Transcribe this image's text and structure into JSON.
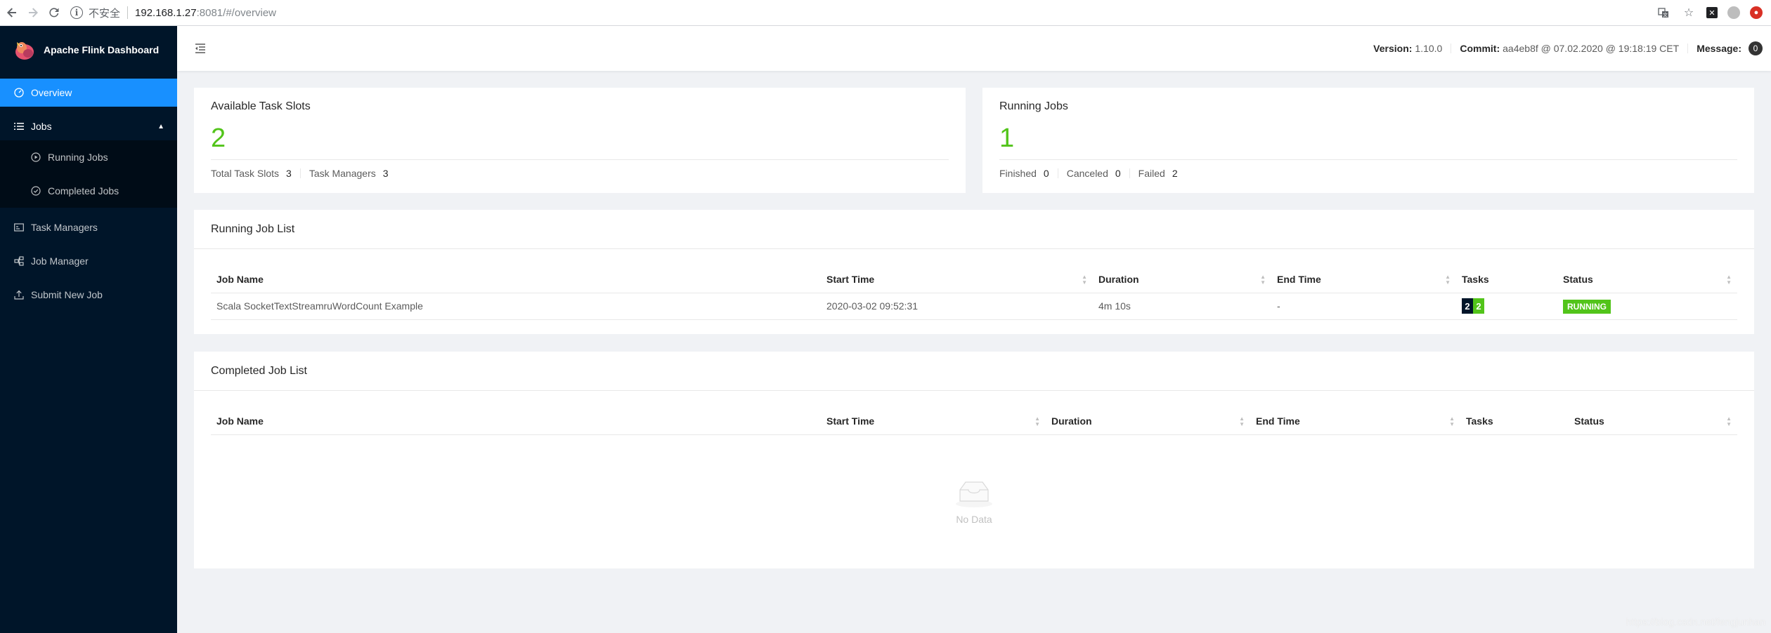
{
  "browser": {
    "insecure_label": "不安全",
    "url_host": "192.168.1.27",
    "url_rest": ":8081/#/overview"
  },
  "sidebar": {
    "logo_text": "Apache Flink Dashboard",
    "items": [
      {
        "label": "Overview"
      },
      {
        "label": "Jobs"
      },
      {
        "label": "Running Jobs"
      },
      {
        "label": "Completed Jobs"
      },
      {
        "label": "Task Managers"
      },
      {
        "label": "Job Manager"
      },
      {
        "label": "Submit New Job"
      }
    ]
  },
  "header": {
    "version_label": "Version:",
    "version_value": "1.10.0",
    "commit_label": "Commit:",
    "commit_value": "aa4eb8f @ 07.02.2020 @ 19:18:19 CET",
    "message_label": "Message:",
    "message_count": "0"
  },
  "slots": {
    "title": "Available Task Slots",
    "value": "2",
    "total_label": "Total Task Slots",
    "total_value": "3",
    "tm_label": "Task Managers",
    "tm_value": "3"
  },
  "running": {
    "title": "Running Jobs",
    "value": "1",
    "finished_label": "Finished",
    "finished_value": "0",
    "canceled_label": "Canceled",
    "canceled_value": "0",
    "failed_label": "Failed",
    "failed_value": "2"
  },
  "running_list": {
    "title": "Running Job List",
    "columns": [
      "Job Name",
      "Start Time",
      "Duration",
      "End Time",
      "Tasks",
      "Status"
    ],
    "rows": [
      {
        "job_name": "Scala SocketTextStreamruWordCount Example",
        "start_time": "2020-03-02 09:52:31",
        "duration": "4m 10s",
        "end_time": "-",
        "tasks_a": "2",
        "tasks_b": "2",
        "status": "RUNNING"
      }
    ]
  },
  "completed_list": {
    "title": "Completed Job List",
    "columns": [
      "Job Name",
      "Start Time",
      "Duration",
      "End Time",
      "Tasks",
      "Status"
    ],
    "empty_text": "No Data"
  },
  "watermark": "https://blog.csdn.net/fengjunhan",
  "colors": {
    "sidebar_bg": "#001529",
    "active": "#1890ff",
    "success": "#52c41a",
    "task_dark": "#001529"
  }
}
